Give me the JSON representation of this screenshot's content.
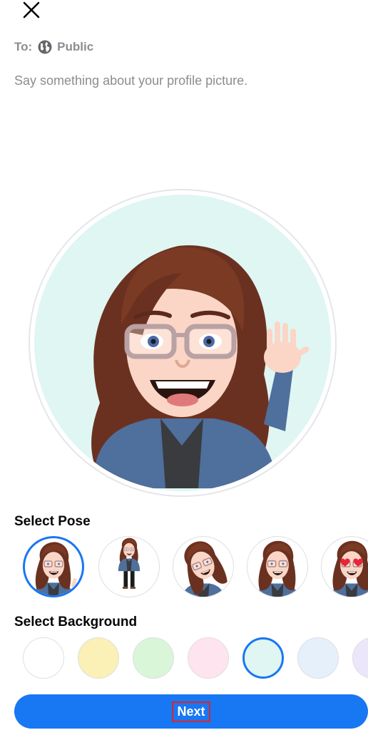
{
  "header": {
    "close_icon": "close-icon",
    "audience_prefix": "To:",
    "audience_icon": "globe-icon",
    "audience_value": "Public",
    "caption_placeholder": "Say something about your profile picture."
  },
  "preview": {
    "background_color": "#dff6f3",
    "avatar": "avatar-waving-pose"
  },
  "poses": {
    "title": "Select Pose",
    "items": [
      {
        "name": "waving",
        "selected": true
      },
      {
        "name": "full-body-wave",
        "selected": false
      },
      {
        "name": "tilted-head",
        "selected": false
      },
      {
        "name": "winking",
        "selected": false
      },
      {
        "name": "heart-eyes",
        "selected": false
      }
    ]
  },
  "backgrounds": {
    "title": "Select Background",
    "items": [
      {
        "color": "#ffffff",
        "selected": false
      },
      {
        "color": "#fbf0b5",
        "selected": false
      },
      {
        "color": "#d9f6d9",
        "selected": false
      },
      {
        "color": "#fde4ee",
        "selected": false
      },
      {
        "color": "#dff6f3",
        "selected": true
      },
      {
        "color": "#e6f0fb",
        "selected": false
      },
      {
        "color": "#ece6fb",
        "selected": false
      }
    ]
  },
  "footer": {
    "next_label": "Next",
    "accent_color": "#1877f2"
  }
}
